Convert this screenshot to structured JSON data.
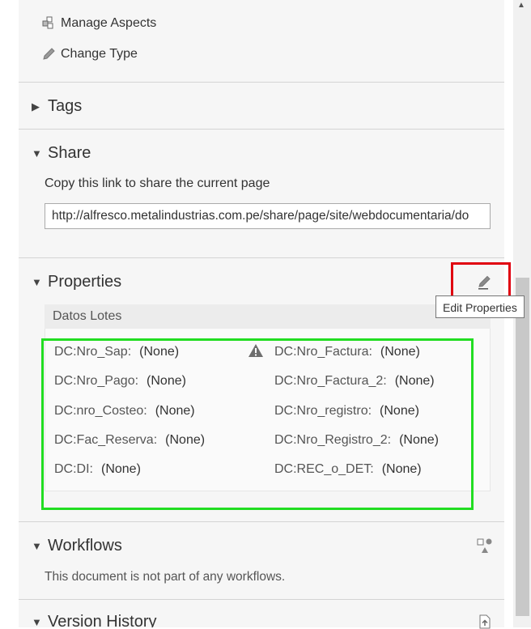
{
  "actions": {
    "manage_aspects": "Manage Aspects",
    "change_type": "Change Type"
  },
  "sections": {
    "tags": {
      "title": "Tags",
      "collapsed": true
    },
    "share": {
      "title": "Share",
      "copy_text": "Copy this link to share the current page",
      "link": "http://alfresco.metalindustrias.com.pe/share/page/site/webdocumentaria/do"
    },
    "properties": {
      "title": "Properties",
      "edit_tooltip": "Edit Properties",
      "group_title": "Datos Lotes",
      "left": [
        {
          "label": "DC:Nro_Sap:",
          "value": "(None)"
        },
        {
          "label": "DC:Nro_Pago:",
          "value": "(None)"
        },
        {
          "label": "DC:nro_Costeo:",
          "value": "(None)"
        },
        {
          "label": "DC:Fac_Reserva:",
          "value": "(None)"
        },
        {
          "label": "DC:DI:",
          "value": "(None)"
        }
      ],
      "right": [
        {
          "label": "DC:Nro_Factura:",
          "value": "(None)"
        },
        {
          "label": "DC:Nro_Factura_2:",
          "value": "(None)"
        },
        {
          "label": "DC:Nro_registro:",
          "value": "(None)"
        },
        {
          "label": "DC:Nro_Registro_2:",
          "value": "(None)"
        },
        {
          "label": "DC:REC_o_DET:",
          "value": "(None)"
        }
      ]
    },
    "workflows": {
      "title": "Workflows",
      "text": "This document is not part of any workflows."
    },
    "version_history": {
      "title": "Version History"
    }
  },
  "annotations": {
    "highlight_red": "#e00010",
    "highlight_green": "#22dd22"
  }
}
